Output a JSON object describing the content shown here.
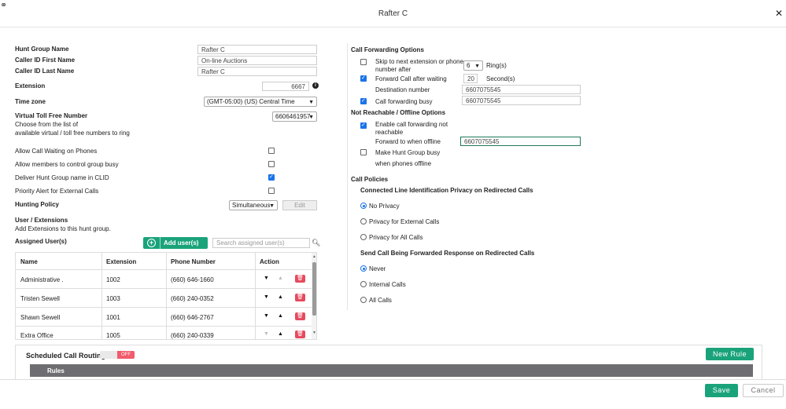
{
  "window": {
    "title": "Rafter C"
  },
  "form": {
    "hunt_group_name_label": "Hunt Group Name",
    "hunt_group_name": "Rafter C",
    "caller_first_label": "Caller ID First Name",
    "caller_first": "On-line Auctions",
    "caller_last_label": "Caller ID Last Name",
    "caller_last": "Rafter C",
    "extension_label": "Extension",
    "extension": "6667",
    "timezone_label": "Time zone",
    "timezone": "(GMT-05:00) (US) Central Time",
    "toll_free_label": "Virtual Toll Free Number",
    "toll_free_help_1": "Choose from the list of",
    "toll_free_help_2": "available virtual / toll free numbers to ring",
    "toll_free": "6606461957",
    "allow_waiting_label": "Allow Call Waiting on Phones",
    "allow_busy_label": "Allow members to control group busy",
    "deliver_name_label": "Deliver Hunt Group name in CLID",
    "priority_alert_label": "Priority Alert for External Calls",
    "hunting_policy_label": "Hunting Policy",
    "hunting_policy": "Simultaneous",
    "edit_label": "Edit",
    "users_title": "User / Extensions",
    "users_help": "Add Extensions to this hunt group.",
    "assigned_label": "Assigned User(s)",
    "add_users_label": "Add user(s)",
    "search_placeholder": "Search assigned user(s)"
  },
  "table": {
    "headers": {
      "name": "Name",
      "extension": "Extension",
      "phone": "Phone Number",
      "action": "Action"
    },
    "rows": [
      {
        "name": "Administrative .",
        "extension": "1002",
        "phone": "(660) 646-1660"
      },
      {
        "name": "Tristen Sewell",
        "extension": "1003",
        "phone": "(660) 240-0352"
      },
      {
        "name": "Shawn Sewell",
        "extension": "1001",
        "phone": "(660) 646-2767"
      },
      {
        "name": "Extra Office",
        "extension": "1005",
        "phone": "(660) 240-0339"
      }
    ]
  },
  "forwarding": {
    "title": "Call Forwarding Options",
    "skip_label_1": "Skip to next extension or phone",
    "skip_label_2": "number after",
    "skip_rings": "6",
    "rings_label": "Ring(s)",
    "forward_wait_label": "Forward Call after waiting",
    "wait_seconds": "20",
    "seconds_label": "Second(s)",
    "destination_label": "Destination number",
    "destination": "6607075545",
    "busy_label": "Call forwarding busy",
    "busy_number": "6607075545",
    "not_reachable_title": "Not Reachable / Offline Options",
    "enable_offline_1": "Enable call forwarding not",
    "enable_offline_2": "reachable",
    "forward_offline_label": "Forward to when offline",
    "offline_number": "6607075545",
    "make_busy_1": "Make Hunt Group busy",
    "make_busy_2": "when phones offline"
  },
  "policies": {
    "title": "Call Policies",
    "clip_title": "Connected Line Identification Privacy on Redirected Calls",
    "clip_options": [
      "No Privacy",
      "Privacy for External Calls",
      "Privacy for All Calls"
    ],
    "fwd_title": "Send Call Being Forwarded Response on Redirected Calls",
    "fwd_options": [
      "Never",
      "Internal Calls",
      "All Calls"
    ]
  },
  "scheduled": {
    "title": "Scheduled Call Routing",
    "toggle": "OFF",
    "new_rule": "New Rule",
    "rules_header": "Rules"
  },
  "footer": {
    "save": "Save",
    "cancel": "Cancel"
  }
}
